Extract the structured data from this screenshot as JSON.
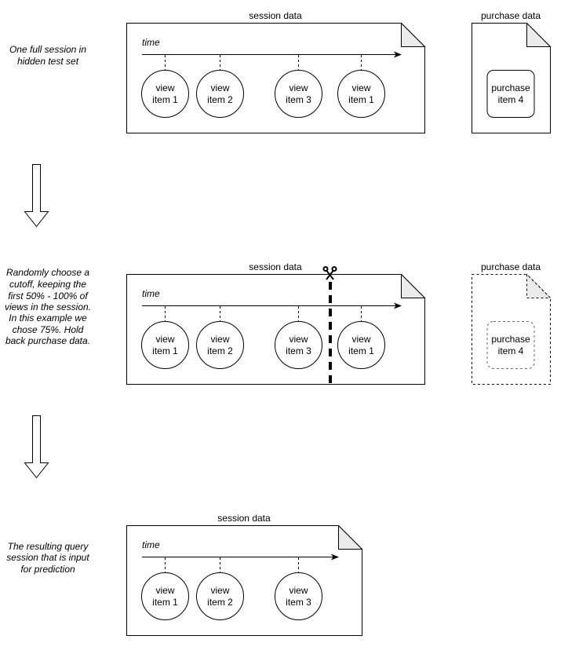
{
  "stages": [
    {
      "caption": [
        "One full session in",
        "hidden test set"
      ],
      "session_label": "session data",
      "time_label": "time",
      "views": [
        {
          "line1": "view",
          "line2": "item 1"
        },
        {
          "line1": "view",
          "line2": "item 2"
        },
        {
          "line1": "view",
          "line2": "item 3"
        },
        {
          "line1": "view",
          "line2": "item 1"
        }
      ],
      "purchase": {
        "label": "purchase data",
        "line1": "purchase",
        "line2": "item 4",
        "style": "solid"
      }
    },
    {
      "caption": [
        "Randomly choose a",
        "cutoff, keeping the",
        "first 50% - 100% of",
        "views in the session.",
        "In this example we",
        "chose 75%. Hold",
        "back purchase data."
      ],
      "session_label": "session data",
      "time_label": "time",
      "cutoff_percent": 75,
      "views": [
        {
          "line1": "view",
          "line2": "item 1"
        },
        {
          "line1": "view",
          "line2": "item 2"
        },
        {
          "line1": "view",
          "line2": "item 3"
        },
        {
          "line1": "view",
          "line2": "item 1"
        }
      ],
      "purchase": {
        "label": "purchase data",
        "line1": "purchase",
        "line2": "item 4",
        "style": "dashed"
      }
    },
    {
      "caption": [
        "The resulting query",
        "session that is input",
        "for prediction"
      ],
      "session_label": "session data",
      "time_label": "time",
      "views": [
        {
          "line1": "view",
          "line2": "item 1"
        },
        {
          "line1": "view",
          "line2": "item 2"
        },
        {
          "line1": "view",
          "line2": "item 3"
        }
      ]
    }
  ],
  "icons": {
    "scissors": "scissors-icon",
    "down_arrow": "down-arrow-icon"
  }
}
